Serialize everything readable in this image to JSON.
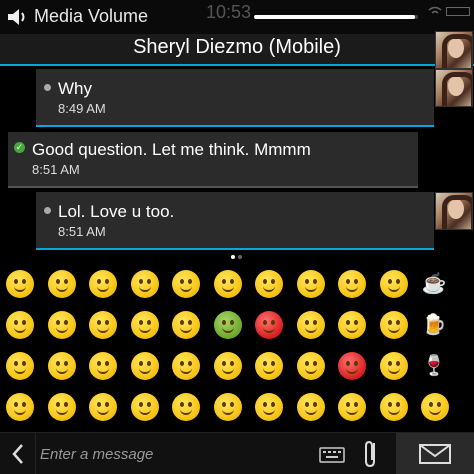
{
  "status": {
    "volume_label": "Media Volume",
    "clock": "10:53",
    "volume_level": 0.98
  },
  "header": {
    "contact_name": "Sheryl Diezmo (Mobile)"
  },
  "messages": [
    {
      "text": "Why",
      "time": "8:49 AM",
      "direction": "incoming"
    },
    {
      "text": "Good question. Let me think. Mmmm",
      "time": "8:51 AM",
      "direction": "outgoing"
    },
    {
      "text": "Lol. Love u too.",
      "time": "8:51 AM",
      "direction": "incoming"
    }
  ],
  "emoji_picker": {
    "page_count": 2,
    "current_page": 1,
    "icons": [
      [
        "smile-icon",
        "laughing-icon",
        "wink-icon",
        "neutral-icon",
        "smirk-icon",
        "frown-icon",
        "crying-icon",
        "confused-icon",
        "dizzy-icon",
        "cool-icon",
        "coffee-icon"
      ],
      [
        "grin-icon",
        "hug-icon",
        "surprised-icon",
        "shy-icon",
        "hand-on-chin-icon",
        "sick-icon",
        "angry-icon",
        "shocked-icon",
        "angel-icon",
        "tongue-icon",
        "beer-icon",
        "gift-icon"
      ],
      [
        "big-grin-icon",
        "tears-of-joy-icon",
        "kiss-heart-icon",
        "eyebrow-raise-icon",
        "rolling-eyes-icon",
        "black-eye-icon",
        "blush-icon",
        "thinking-icon",
        "devil-icon",
        "tongue-wink-icon",
        "wine-icon",
        "cake-icon"
      ],
      [
        "laughing-tears-icon",
        "party-icon",
        "kiss-icon",
        "unamused-icon",
        "facepalm-icon",
        "worried-icon",
        "sweat-icon",
        "yawn-icon",
        "scream-icon",
        "nerd-icon",
        "eyes-icon",
        "dinner-icon",
        "star-icon"
      ]
    ]
  },
  "input": {
    "placeholder": "Enter a message"
  },
  "colors": {
    "accent": "#00a8df",
    "background": "#000000",
    "bubble": "#2b2b2b",
    "delivered_check": "#46a83a"
  }
}
